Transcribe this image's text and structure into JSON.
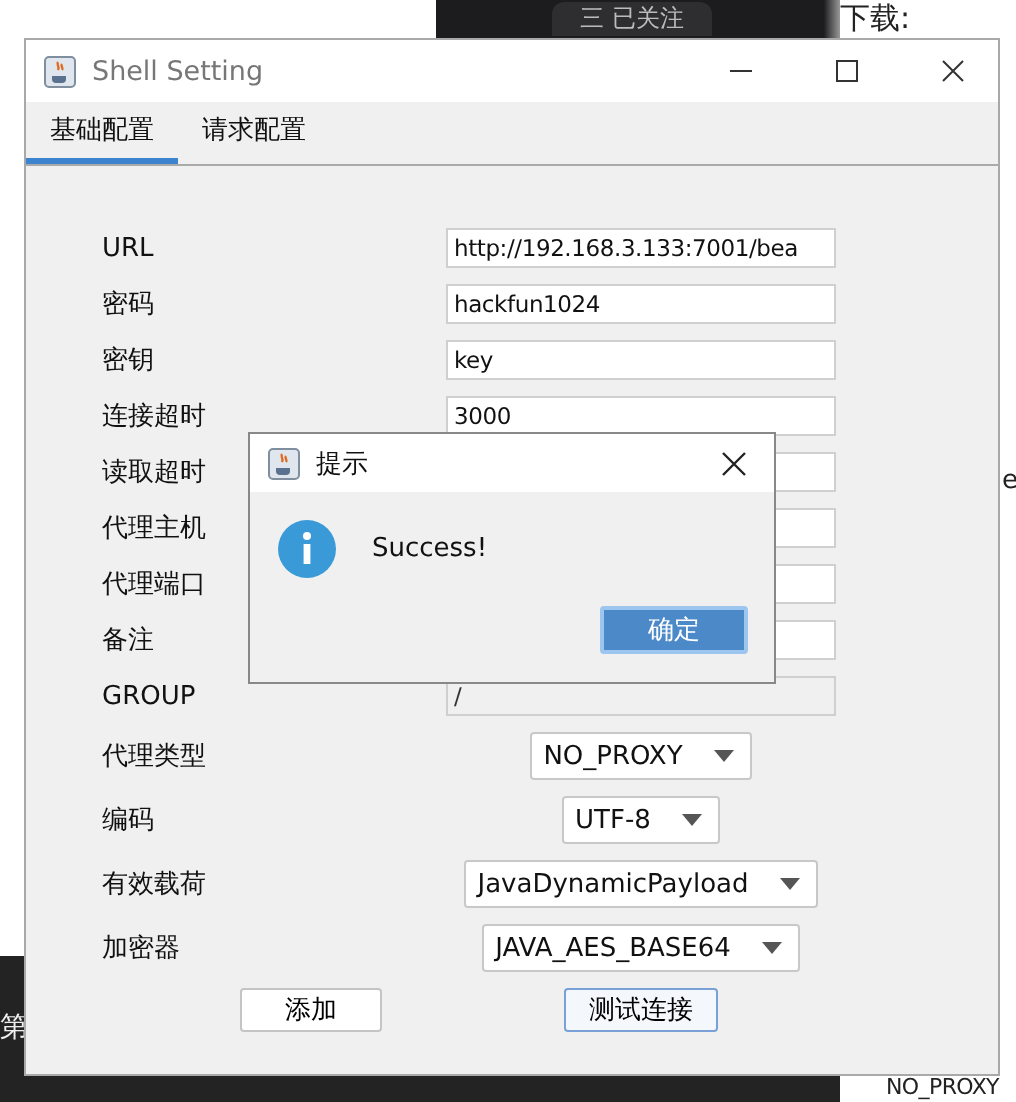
{
  "background": {
    "follow_button": "三 已关注",
    "download_label": "下载:",
    "side_text": "第",
    "bottom_text": "NO_PROXY",
    "fragments": [
      {
        "kind": "plain",
        "text": "e"
      }
    ]
  },
  "window": {
    "title": "Shell Setting",
    "tabs": [
      {
        "label": "基础配置",
        "selected": true
      },
      {
        "label": "请求配置",
        "selected": false
      }
    ],
    "fields": [
      {
        "kind": "text",
        "label": "URL",
        "value": "http://192.168.3.133:7001/bea"
      },
      {
        "kind": "text",
        "label": "密码",
        "value": "hackfun1024"
      },
      {
        "kind": "text",
        "label": "密钥",
        "value": "key"
      },
      {
        "kind": "text",
        "label": "连接超时",
        "value": "3000"
      },
      {
        "kind": "text",
        "label": "读取超时"
      },
      {
        "kind": "text",
        "label": "代理主机"
      },
      {
        "kind": "text",
        "label": "代理端口"
      },
      {
        "kind": "text",
        "label": "备注"
      },
      {
        "kind": "text",
        "label": "GROUP",
        "value": "/",
        "disabled": true
      },
      {
        "kind": "select",
        "label": "代理类型",
        "value": "NO_PROXY"
      },
      {
        "kind": "select",
        "label": "编码",
        "value": "UTF-8"
      },
      {
        "kind": "select",
        "label": "有效载荷",
        "value": "JavaDynamicPayload"
      },
      {
        "kind": "select",
        "label": "加密器",
        "value": "JAVA_AES_BASE64"
      }
    ],
    "buttons": [
      {
        "label": "添加",
        "focused": false
      },
      {
        "label": "测试连接",
        "focused": true
      }
    ]
  },
  "dialog": {
    "title": "提示",
    "message": "Success!",
    "button": "确定"
  }
}
